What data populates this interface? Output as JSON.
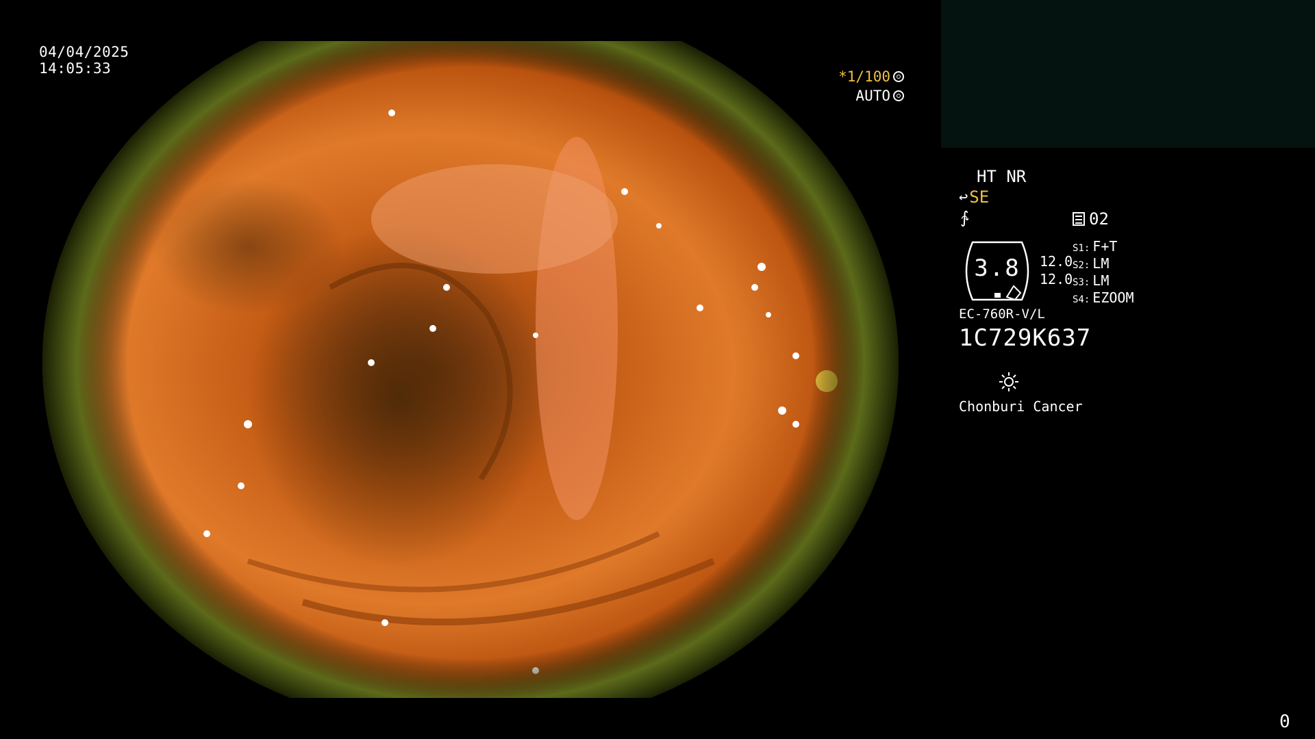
{
  "timestamp": {
    "date": "04/04/2025",
    "time": "14:05:33"
  },
  "image_overlay": {
    "shutter": "*1/100",
    "shutter_icon": "aperture-icon",
    "iris": "AUTO",
    "iris_icon": "iris-ring-icon",
    "shutter_color": "#f0c040"
  },
  "info": {
    "mode": "HT NR",
    "structure_enhance": "SE",
    "structure_icon": "hook-icon",
    "color_icon": "curve-icon",
    "memo_number": "02",
    "memo_icon": "memo-icon",
    "gauge_value": "3.8",
    "value_a": "12.0",
    "value_b": "12.0",
    "switches": [
      {
        "key": "S1:",
        "value": "F+T"
      },
      {
        "key": "S2:",
        "value": "LM"
      },
      {
        "key": "S3:",
        "value": "LM"
      },
      {
        "key": "S4:",
        "value": "EZOOM"
      }
    ],
    "model": "EC-760R-V/L",
    "serial": "1C729K637",
    "light_icon": "sun-icon",
    "hospital": "Chonburi Cancer"
  },
  "counter": "0"
}
